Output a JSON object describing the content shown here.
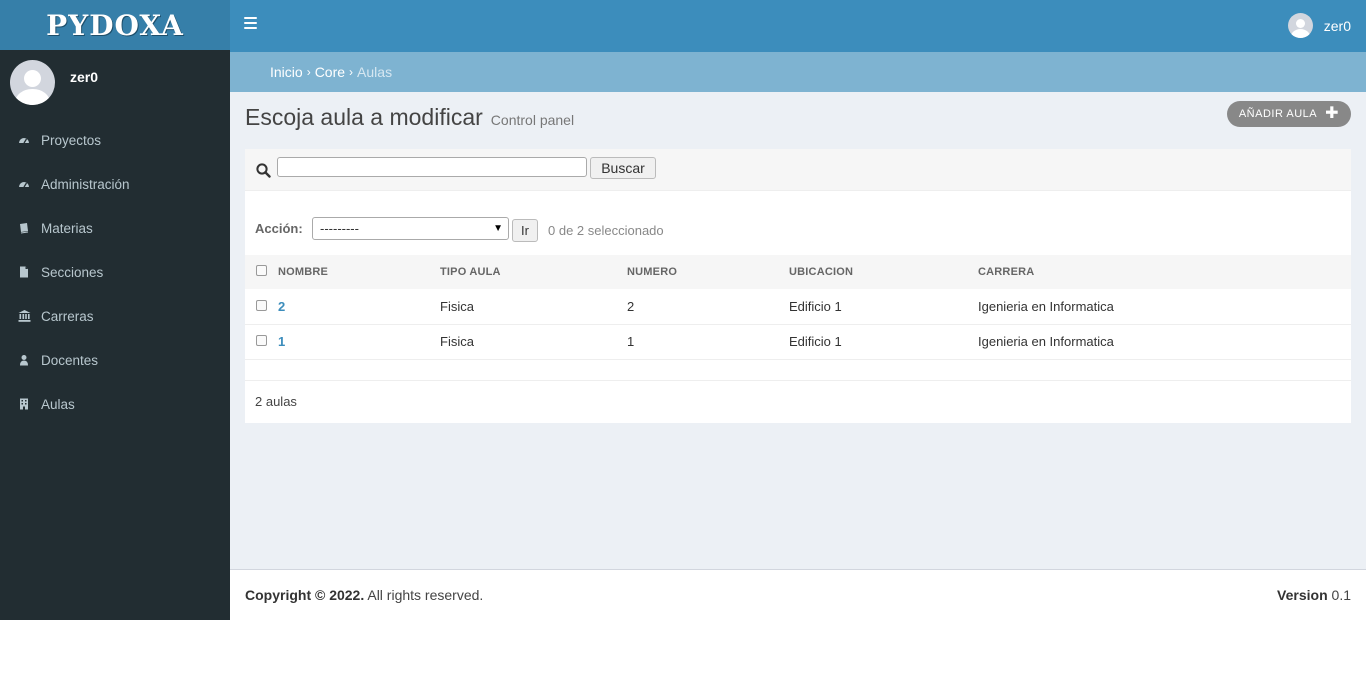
{
  "brand": {
    "logo_text": "PYDOXA"
  },
  "header": {
    "user_name": "zer0"
  },
  "sidebar": {
    "user_name": "zer0",
    "items": [
      {
        "label": "Proyectos",
        "icon": "dashboard-icon"
      },
      {
        "label": "Administración",
        "icon": "dashboard-icon"
      },
      {
        "label": "Materias",
        "icon": "book-icon"
      },
      {
        "label": "Secciones",
        "icon": "file-icon"
      },
      {
        "label": "Carreras",
        "icon": "university-icon"
      },
      {
        "label": "Docentes",
        "icon": "user-icon"
      },
      {
        "label": "Aulas",
        "icon": "building-icon"
      }
    ]
  },
  "breadcrumb": {
    "home": "Inicio",
    "section": "Core",
    "current": "Aulas",
    "separator": "›"
  },
  "page": {
    "title": "Escoja aula a modificar",
    "subtitle": "Control panel",
    "add_button": "AÑADIR AULA"
  },
  "search": {
    "value": "",
    "button": "Buscar"
  },
  "actions": {
    "label": "Acción:",
    "selected": "---------",
    "go_button": "Ir",
    "selection_count": "0 de 2 seleccionado"
  },
  "table": {
    "columns": [
      "NOMBRE",
      "TIPO AULA",
      "NUMERO",
      "UBICACION",
      "CARRERA"
    ],
    "rows": [
      {
        "nombre": "2",
        "tipo": "Fisica",
        "numero": "2",
        "ubicacion": "Edificio 1",
        "carrera": "Igenieria en Informatica"
      },
      {
        "nombre": "1",
        "tipo": "Fisica",
        "numero": "1",
        "ubicacion": "Edificio 1",
        "carrera": "Igenieria en Informatica"
      }
    ]
  },
  "paginator": {
    "text": "2 aulas"
  },
  "footer": {
    "copyright_bold": "Copyright © 2022.",
    "copyright_rest": " All rights reserved.",
    "version_label": "Version",
    "version_value": " 0.1"
  }
}
